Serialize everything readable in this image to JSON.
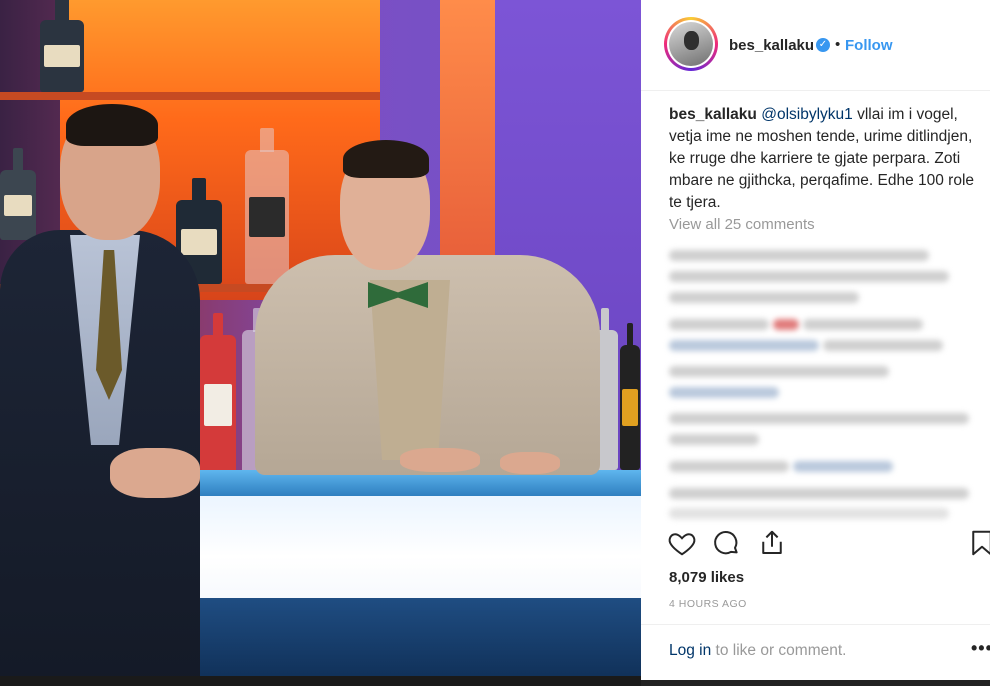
{
  "post": {
    "username": "bes_kallaku",
    "follow_label": "Follow",
    "dot": "•",
    "verified_mark": "✓",
    "caption_user": "bes_kallaku",
    "caption_mention": "@olsibylyku1",
    "caption_text": " vllai im i vogel, vetja ime ne moshen tende, urime ditlindjen, ke rruge dhe karriere te gjate perpara. Zoti mbare ne gjithcka, perqafime. Edhe 100 role te tjera.",
    "view_all_comments": "View all 25 comments",
    "likes": "8,079 likes",
    "time_ago": "4 HOURS AGO",
    "login_link": "Log in",
    "login_suffix": " to like or comment.",
    "more_label": "•••"
  },
  "icons": {
    "like": "heart-icon",
    "comment": "comment-icon",
    "share": "share-icon",
    "save": "bookmark-icon"
  },
  "colors": {
    "accent": "#3897f0",
    "text": "#262626",
    "muted": "#999999",
    "link": "#003569"
  }
}
